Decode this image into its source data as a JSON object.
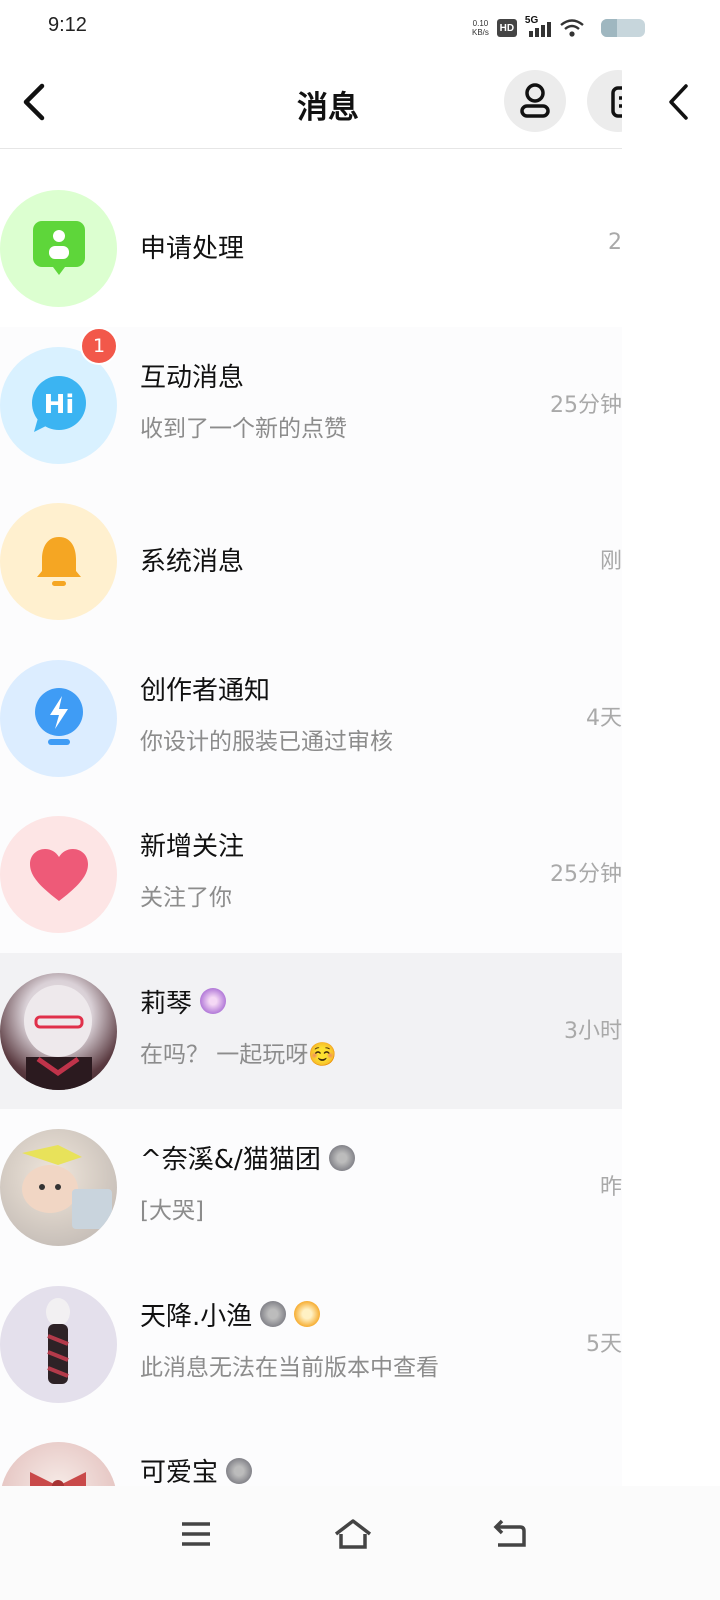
{
  "status": {
    "time": "9:12",
    "net_speed_value": "0.10",
    "net_speed_unit": "KB/s",
    "hd": "HD",
    "signal": "5G"
  },
  "header": {
    "title": "消息"
  },
  "rows": [
    {
      "name": "申请处理",
      "preview": "",
      "time": "2",
      "icon": "apply-icon",
      "bg": "#dcffd0"
    },
    {
      "name": "互动消息",
      "preview": "收到了一个新的点赞",
      "time": "25分钟",
      "icon": "hi-bubble-icon",
      "bg": "#d9f1ff",
      "badge": "1"
    },
    {
      "name": "系统消息",
      "preview": "",
      "time": "刚",
      "icon": "bell-icon",
      "bg": "#fff0cf"
    },
    {
      "name": "创作者通知",
      "preview": "你设计的服装已通过审核",
      "time": "4天",
      "icon": "bulb-icon",
      "bg": "#dcedff"
    },
    {
      "name": "新增关注",
      "preview": "关注了你",
      "time": "25分钟",
      "icon": "heart-icon",
      "bg": "#fde5e5"
    },
    {
      "name": "莉琴",
      "preview": "在吗？ 一起玩呀☺️",
      "time": "3小时",
      "icon": "user-avatar"
    },
    {
      "name": "^奈溪&/猫猫团",
      "preview": "[大哭]",
      "time": "昨",
      "icon": "user-avatar"
    },
    {
      "name": "天降.小渔",
      "preview": "此消息无法在当前版本中查看",
      "time": "5天",
      "icon": "user-avatar"
    },
    {
      "name": "可爱宝",
      "preview": "",
      "time": "",
      "icon": "user-avatar"
    }
  ],
  "colors": {
    "accent_green": "#5ed63a",
    "hi_blue": "#3bb4f2",
    "bell_orange": "#f5a623",
    "bulb_blue": "#3f9cf5",
    "heart_red": "#ee5a78",
    "badge_red": "#f2584a"
  }
}
